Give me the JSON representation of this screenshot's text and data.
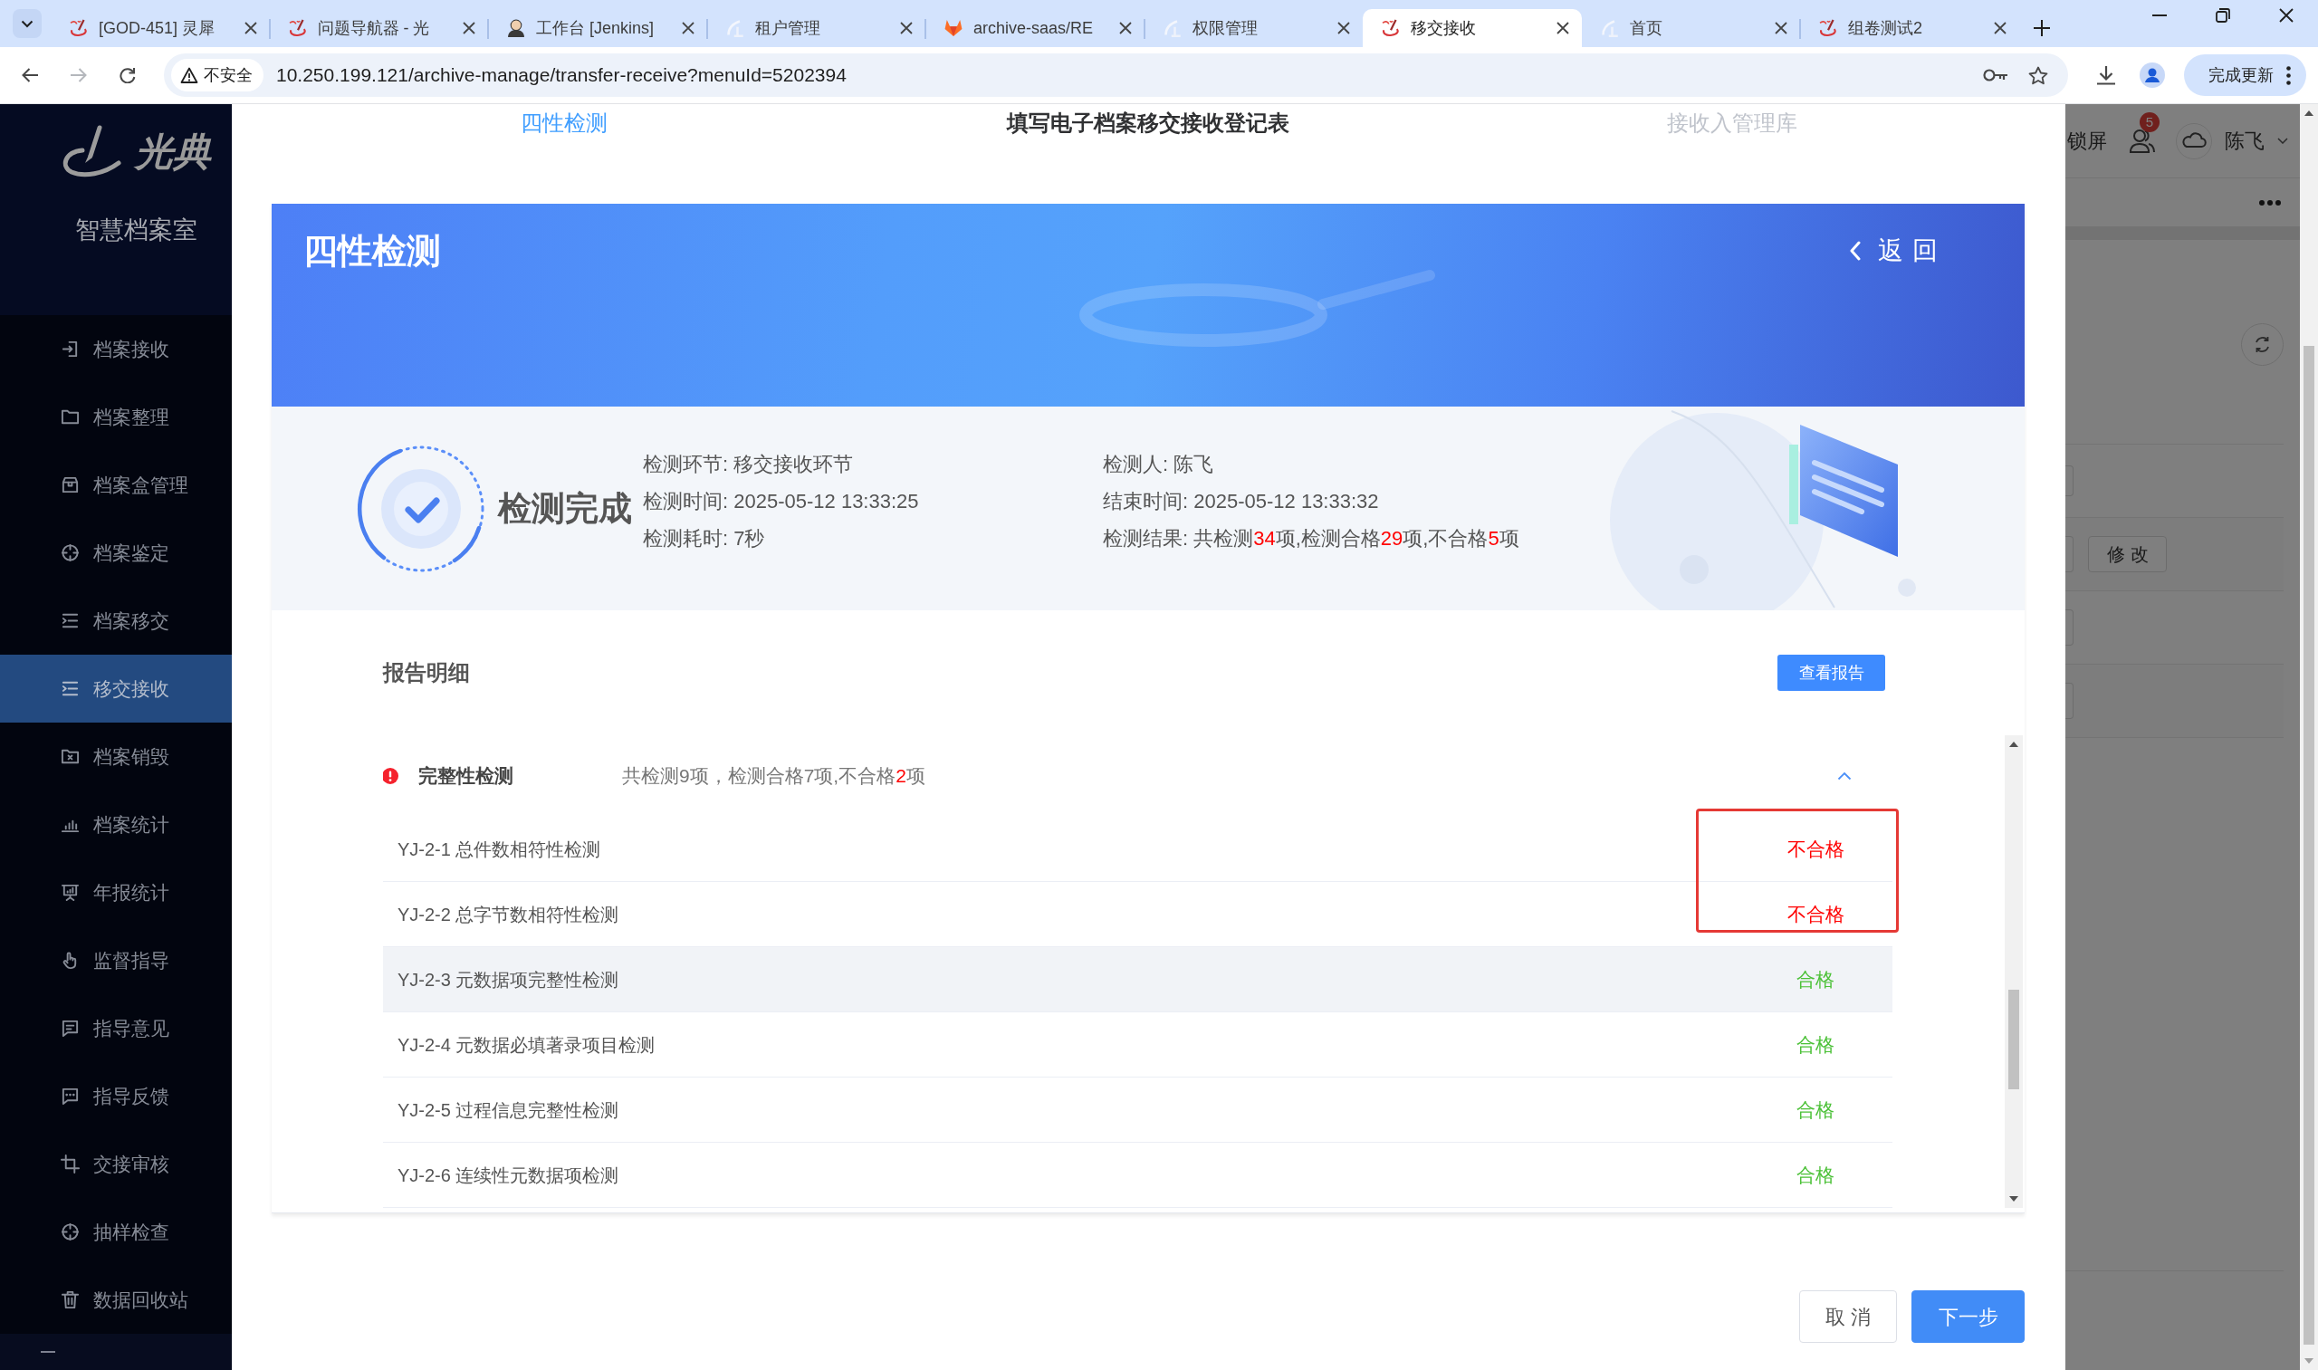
{
  "browser": {
    "tabs": [
      {
        "title": "[GOD-451] 灵犀",
        "kind": "brush",
        "selected": false
      },
      {
        "title": "问题导航器 - 光",
        "kind": "brush",
        "selected": false
      },
      {
        "title": "工作台 [Jenkins]",
        "kind": "butler",
        "selected": false
      },
      {
        "title": "租户管理",
        "kind": "pale",
        "selected": false
      },
      {
        "title": "archive-saas/RE",
        "kind": "fox",
        "selected": false
      },
      {
        "title": "权限管理",
        "kind": "pale",
        "selected": false
      },
      {
        "title": "移交接收",
        "kind": "brush",
        "selected": true
      },
      {
        "title": "首页",
        "kind": "pale",
        "selected": false
      },
      {
        "title": "组卷测试2",
        "kind": "brush",
        "selected": false
      }
    ],
    "nav_buttons": [
      {
        "kind": "back",
        "disabled": false
      },
      {
        "kind": "forward",
        "disabled": true
      },
      {
        "kind": "reload",
        "disabled": false
      }
    ],
    "security_label": "不安全",
    "url": "10.250.199.121/archive-manage/transfer-receive?menuId=5202394",
    "update_button": "完成更新"
  },
  "sidebar": {
    "logo_text": "光典",
    "subtitle": "智慧档案室",
    "items": [
      {
        "label": "档案接收",
        "kind": "enter",
        "selected": false
      },
      {
        "label": "档案整理",
        "kind": "folder",
        "selected": false
      },
      {
        "label": "档案盒管理",
        "kind": "box",
        "selected": false
      },
      {
        "label": "档案鉴定",
        "kind": "crosshair",
        "selected": false
      },
      {
        "label": "档案移交",
        "kind": "list",
        "selected": false
      },
      {
        "label": "移交接收",
        "kind": "list",
        "selected": true
      },
      {
        "label": "档案销毁",
        "kind": "folderx",
        "selected": false
      },
      {
        "label": "档案统计",
        "kind": "barchart",
        "selected": false
      },
      {
        "label": "年报统计",
        "kind": "easel",
        "selected": false
      },
      {
        "label": "监督指导",
        "kind": "hand",
        "selected": false
      },
      {
        "label": "指导意见",
        "kind": "message",
        "selected": false
      },
      {
        "label": "指导反馈",
        "kind": "chat",
        "selected": false
      },
      {
        "label": "交接审核",
        "kind": "crop",
        "selected": false
      },
      {
        "label": "抽样检查",
        "kind": "crosshair",
        "selected": false
      },
      {
        "label": "数据回收站",
        "kind": "trash",
        "selected": false
      }
    ]
  },
  "background_page": {
    "lock_label": "锁屏",
    "notification_count": "5",
    "user_name": "陈飞",
    "edit_button": "修改"
  },
  "steps": [
    {
      "label": "四性检测",
      "completed": true,
      "selected": false
    },
    {
      "label": "填写电子档案移交接收登记表",
      "completed": false,
      "selected": true
    },
    {
      "label": "接收入管理库",
      "completed": false,
      "selected": false
    }
  ],
  "banner": {
    "title": "四性检测",
    "back_button": "返回"
  },
  "summary": {
    "status": "检测完成",
    "columns": [
      [
        {
          "label": "检测环节:",
          "parts": [
            {
              "text": "移交接收环节",
              "alert": false
            }
          ]
        },
        {
          "label": "检测时间:",
          "parts": [
            {
              "text": "2025-05-12 13:33:25",
              "alert": false
            }
          ]
        },
        {
          "label": "检测耗时:",
          "parts": [
            {
              "text": "7秒",
              "alert": false
            }
          ]
        }
      ],
      [
        {
          "label": "检测人:",
          "parts": [
            {
              "text": "陈飞",
              "alert": false
            }
          ]
        },
        {
          "label": "结束时间:",
          "parts": [
            {
              "text": "2025-05-12 13:33:32",
              "alert": false
            }
          ]
        },
        {
          "label": "检测结果:",
          "parts": [
            {
              "text": "共检测",
              "alert": false
            },
            {
              "text": "34",
              "alert": true
            },
            {
              "text": "项,检测合格",
              "alert": false
            },
            {
              "text": "29",
              "alert": true
            },
            {
              "text": "项,不合格",
              "alert": false
            },
            {
              "text": "5",
              "alert": true
            },
            {
              "text": "项",
              "alert": false
            }
          ]
        }
      ]
    ]
  },
  "report": {
    "title": "报告明细",
    "view_button": "查看报告",
    "groups": [
      {
        "name": "完整性检测",
        "passed": false,
        "expanded": true,
        "summary": [
          {
            "text": "共检测9项，检测合格7项,不合格",
            "alert": false
          },
          {
            "text": "2",
            "alert": true
          },
          {
            "text": "项",
            "alert": false
          }
        ],
        "items": [
          {
            "name": "YJ-2-1 总件数相符性检测",
            "result": "不合格",
            "passed": false,
            "highlighted": true,
            "hovered": false
          },
          {
            "name": "YJ-2-2 总字节数相符性检测",
            "result": "不合格",
            "passed": false,
            "highlighted": true,
            "hovered": false
          },
          {
            "name": "YJ-2-3 元数据项完整性检测",
            "result": "合格",
            "passed": true,
            "highlighted": false,
            "hovered": true
          },
          {
            "name": "YJ-2-4 元数据必填著录项目检测",
            "result": "合格",
            "passed": true,
            "highlighted": false,
            "hovered": false
          },
          {
            "name": "YJ-2-5 过程信息完整性检测",
            "result": "合格",
            "passed": true,
            "highlighted": false,
            "hovered": false
          },
          {
            "name": "YJ-2-6 连续性元数据项检测",
            "result": "合格",
            "passed": true,
            "highlighted": false,
            "hovered": false
          }
        ]
      }
    ]
  },
  "footer": {
    "buttons": [
      {
        "label": "取消",
        "kind": "secondary"
      },
      {
        "label": "下一步",
        "kind": "primary"
      }
    ]
  }
}
